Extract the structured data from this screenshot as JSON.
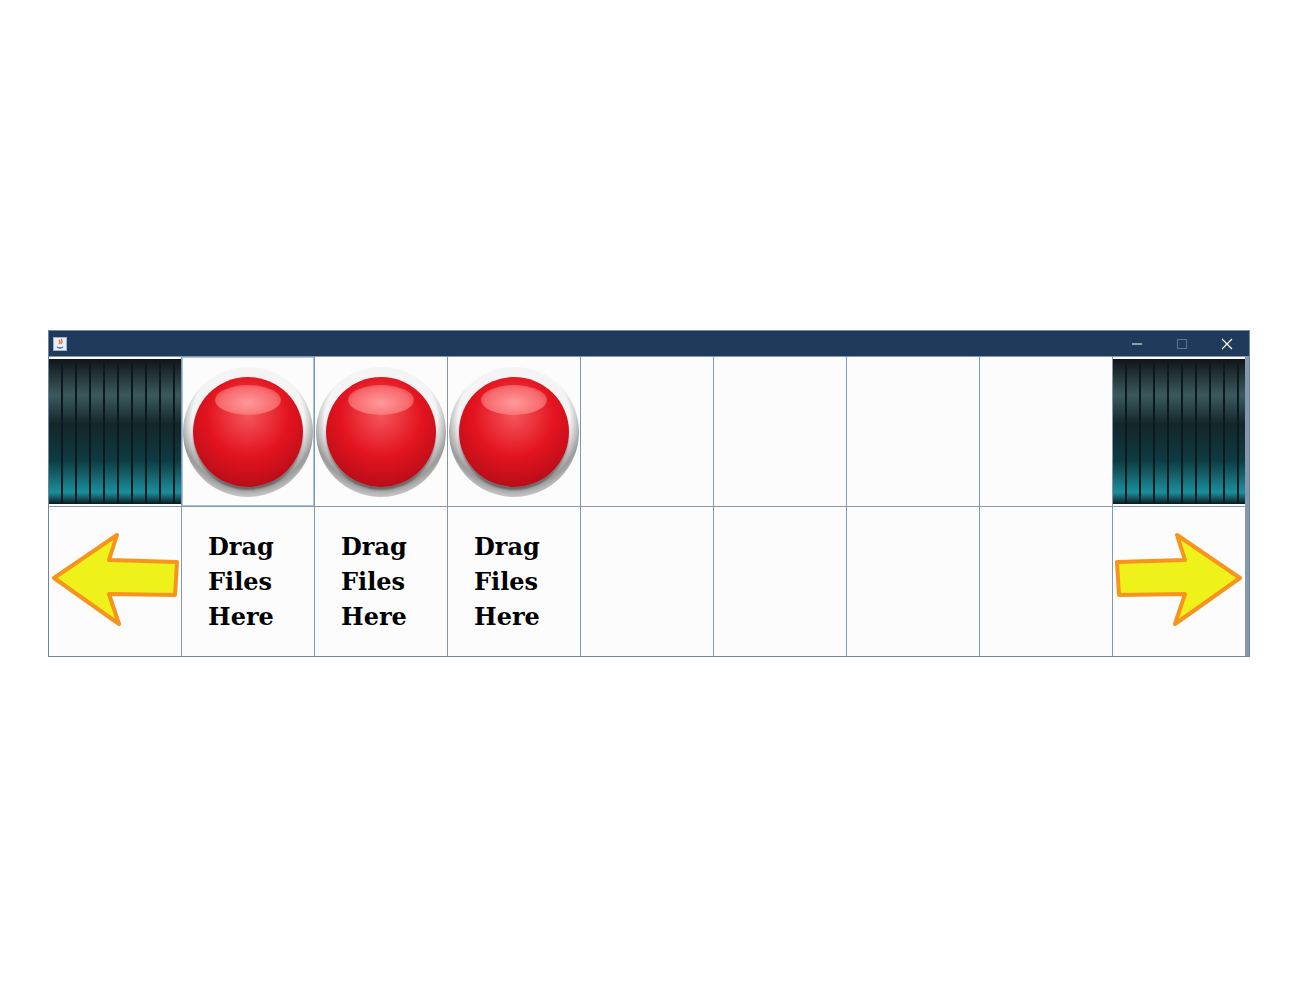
{
  "window": {
    "maximize_enabled": false
  },
  "pads": [
    {
      "kind": "button",
      "label": "Drag Files Here"
    },
    {
      "kind": "button",
      "label": "Drag Files Here"
    },
    {
      "kind": "button",
      "label": "Drag Files Here"
    },
    {
      "kind": "empty",
      "label": ""
    },
    {
      "kind": "empty",
      "label": ""
    },
    {
      "kind": "empty",
      "label": ""
    },
    {
      "kind": "empty",
      "label": ""
    }
  ]
}
